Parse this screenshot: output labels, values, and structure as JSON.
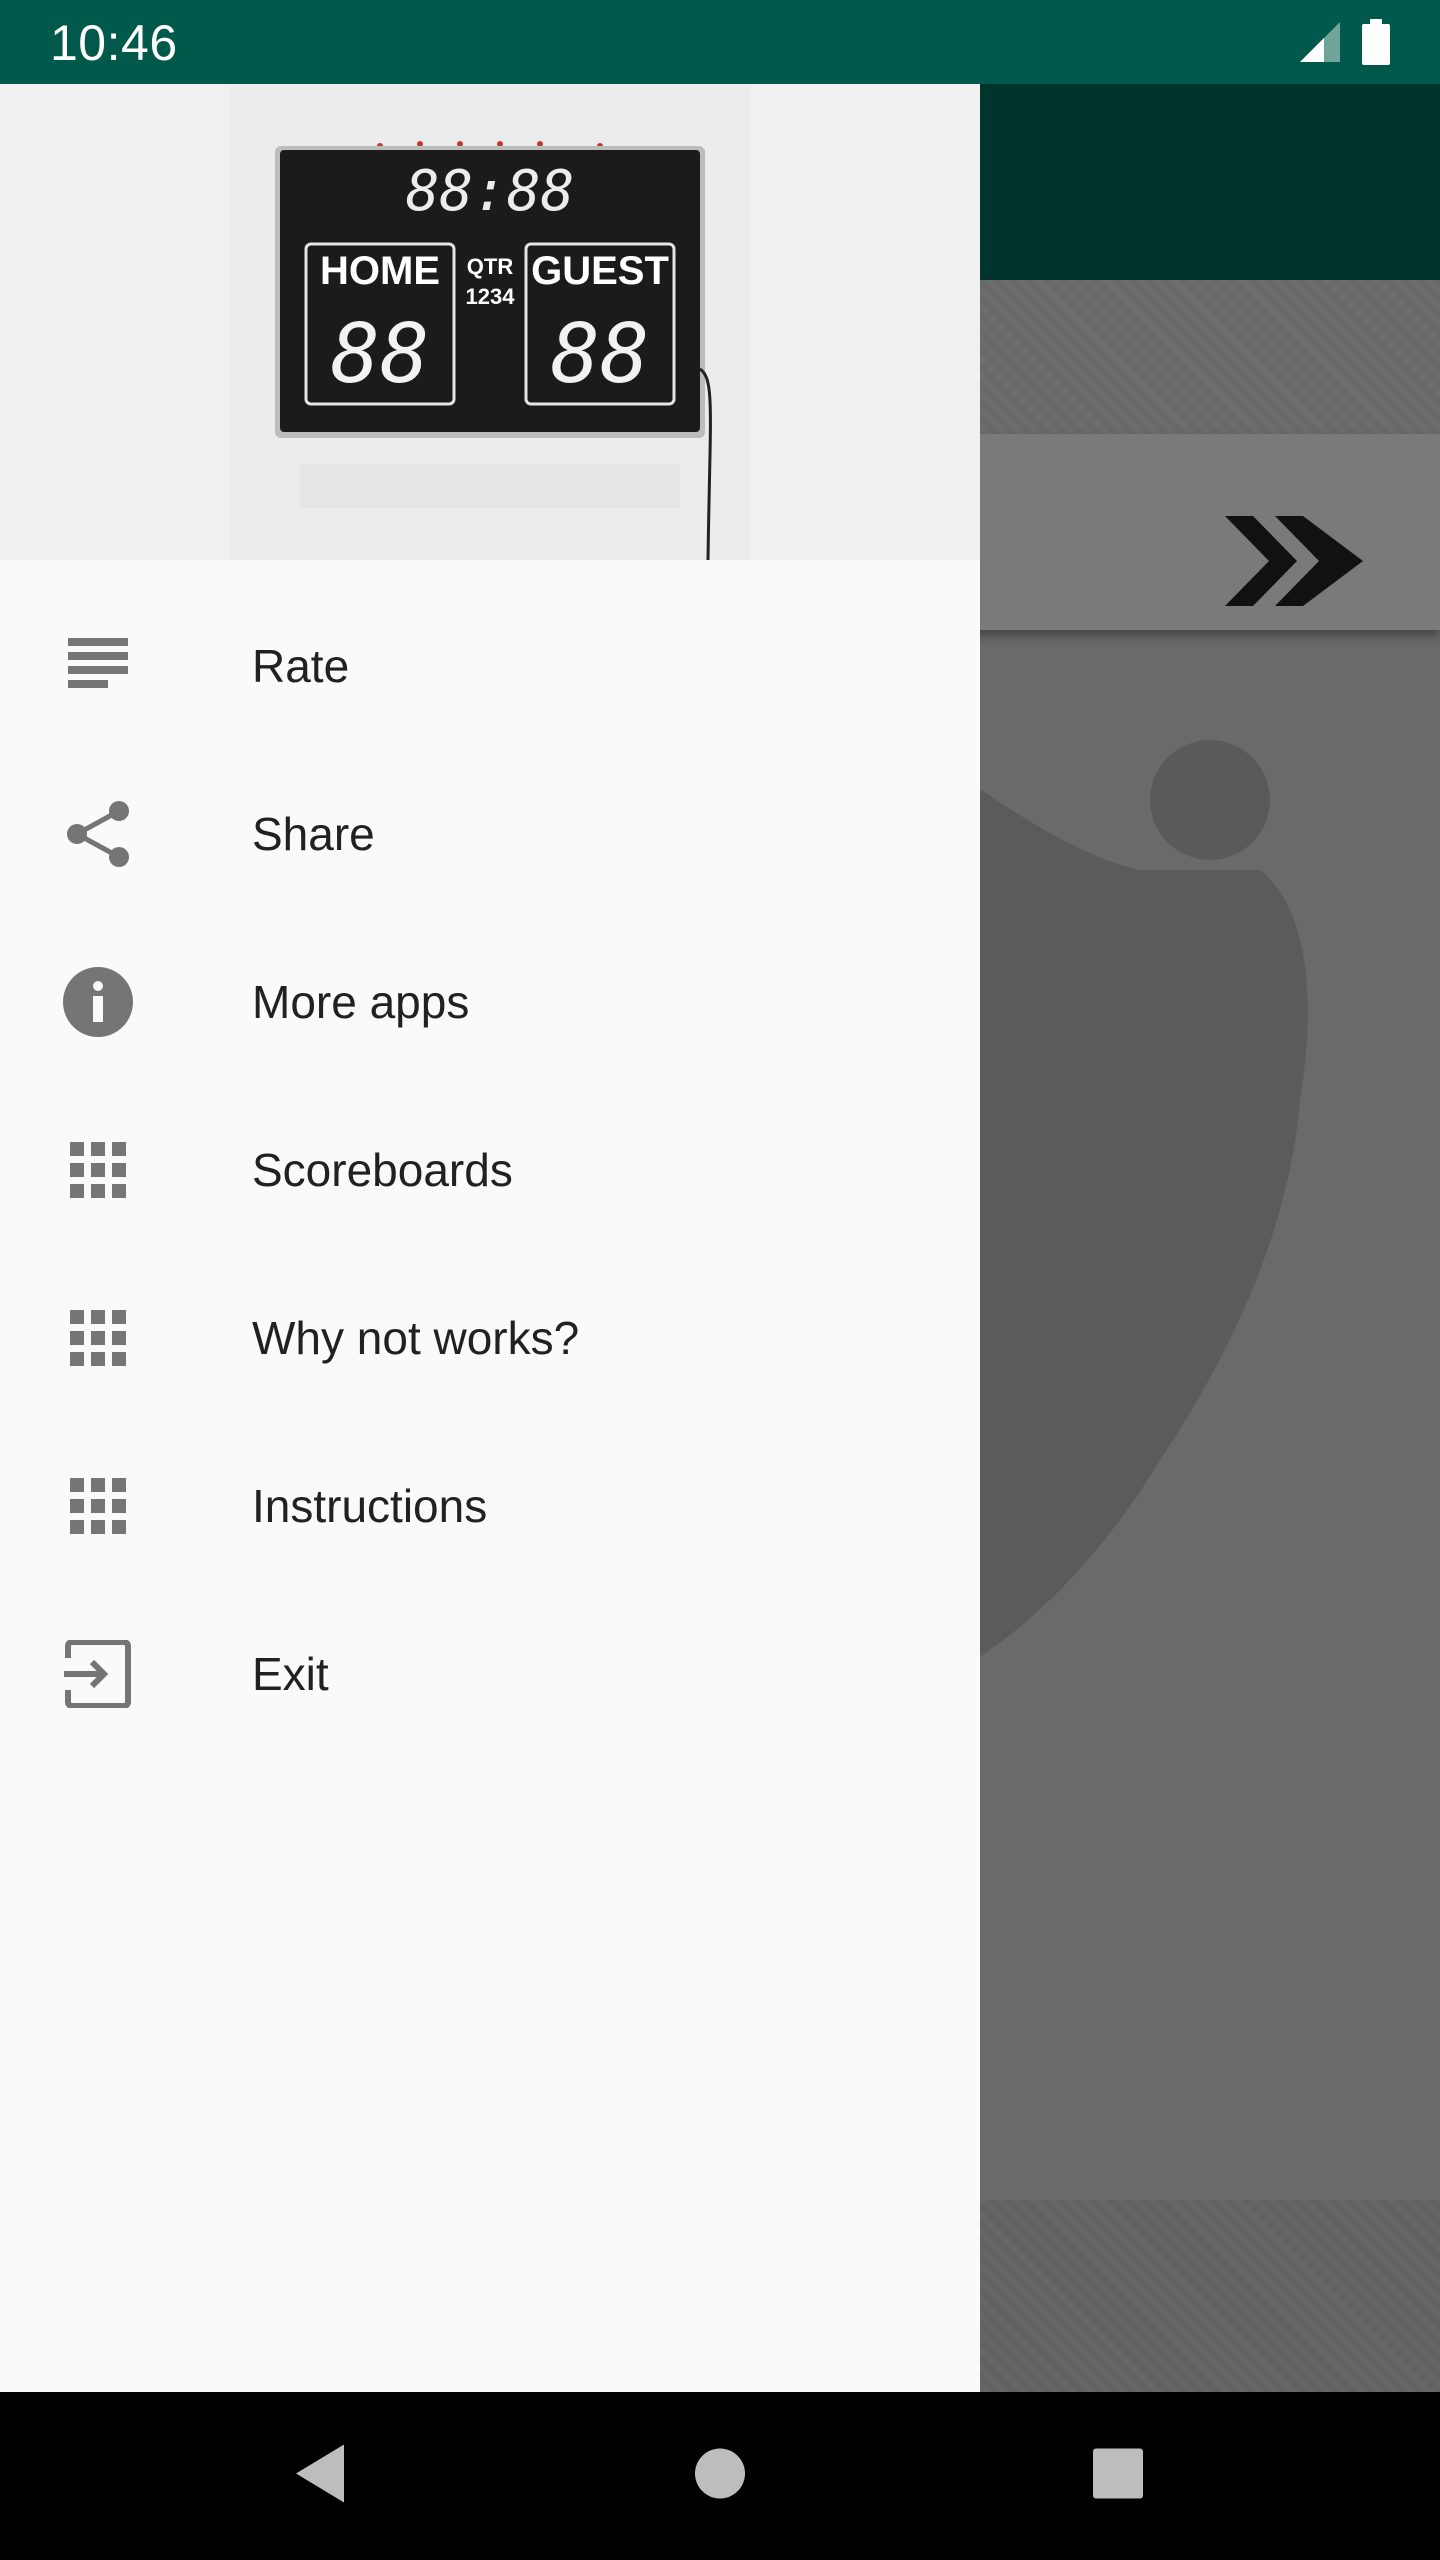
{
  "status_bar": {
    "time": "10:46",
    "icons": [
      "signal-icon",
      "battery-icon"
    ]
  },
  "drawer": {
    "header_image": {
      "description_icon": "scoreboard-image",
      "clock": "88:88",
      "home_label": "HOME",
      "guest_label": "GUEST",
      "qtr_label": "QTR",
      "qtr_digits": "1234",
      "home_digits": "88",
      "guest_digits": "88"
    },
    "menu_items": [
      {
        "id": "rate",
        "label": "Rate",
        "icon": "sort-lines-icon"
      },
      {
        "id": "share",
        "label": "Share",
        "icon": "share-icon"
      },
      {
        "id": "more-apps",
        "label": "More apps",
        "icon": "info-icon"
      },
      {
        "id": "scoreboards",
        "label": "Scoreboards",
        "icon": "grid-icon"
      },
      {
        "id": "why-not-works",
        "label": "Why not works?",
        "icon": "grid-icon"
      },
      {
        "id": "instructions",
        "label": "Instructions",
        "icon": "grid-icon"
      },
      {
        "id": "exit",
        "label": "Exit",
        "icon": "exit-icon"
      }
    ]
  },
  "nav_bar": {
    "buttons": [
      "back-icon",
      "home-icon",
      "recents-icon"
    ]
  },
  "colors": {
    "status_bar": "#00594a",
    "app_toolbar": "#00332b",
    "drawer_bg": "#fafafa",
    "icon_gray": "#757575",
    "text": "#212121"
  }
}
